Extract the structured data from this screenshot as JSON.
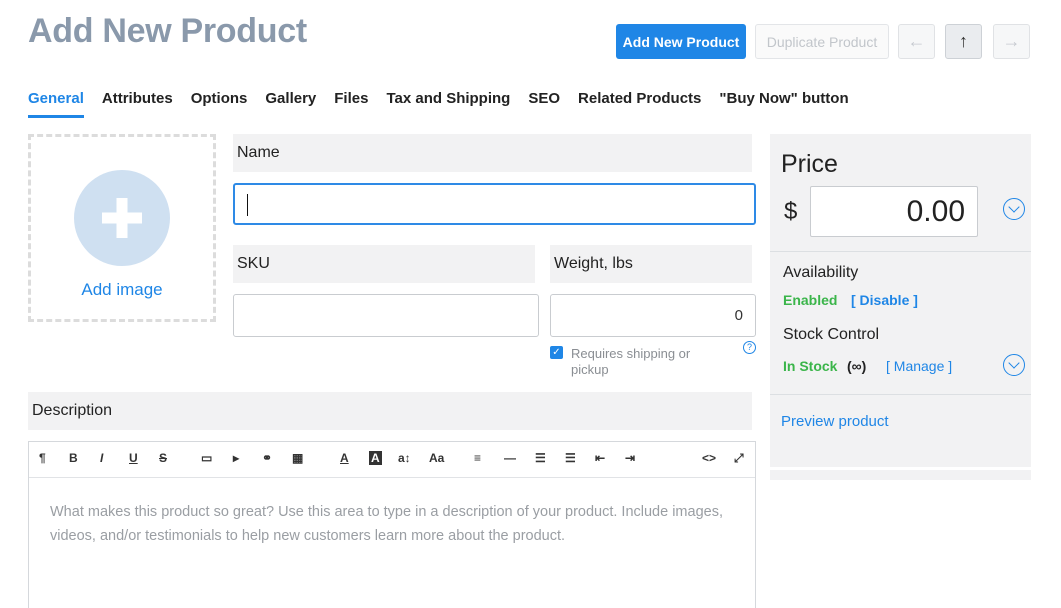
{
  "header": {
    "title": "Add New Product",
    "add_button": "Add New Product",
    "duplicate_button": "Duplicate Product",
    "prev_icon": "←",
    "up_icon": "↑",
    "next_icon": "→"
  },
  "tabs": [
    {
      "label": "General",
      "active": true
    },
    {
      "label": "Attributes"
    },
    {
      "label": "Options"
    },
    {
      "label": "Gallery"
    },
    {
      "label": "Files"
    },
    {
      "label": "Tax and Shipping"
    },
    {
      "label": "SEO"
    },
    {
      "label": "Related Products"
    },
    {
      "label": "\"Buy Now\" button"
    }
  ],
  "image": {
    "label": "Add image"
  },
  "form": {
    "name_label": "Name",
    "name_value": "",
    "sku_label": "SKU",
    "sku_value": "",
    "weight_label": "Weight, lbs",
    "weight_value": "0",
    "shipping_checkbox": "Requires shipping or pickup",
    "help_icon": "?"
  },
  "description": {
    "label": "Description",
    "placeholder": "What makes this product so great? Use this area to type in a description of your product. Include images, videos, and/or testimonials to help new customers learn more about the product.",
    "toolbar": {
      "paragraph": "¶",
      "bold": "B",
      "italic": "I",
      "underline": "U",
      "strike": "S",
      "image": "▭",
      "video": "▸",
      "link": "⚭",
      "table": "▦",
      "font_color": "A",
      "bg_color": "A",
      "font_size": "a↕",
      "font_family": "Aa",
      "align": "≡",
      "hr": "—",
      "ul": "☰",
      "ol": "☰",
      "outdent": "⇤",
      "indent": "⇥",
      "code": "<>",
      "fullscreen": "⤢"
    }
  },
  "price": {
    "title": "Price",
    "currency": "$",
    "value": "0.00"
  },
  "availability": {
    "title": "Availability",
    "state": "Enabled",
    "link": "[ Disable ]"
  },
  "stock": {
    "title": "Stock Control",
    "state": "In Stock",
    "infinity": "(∞)",
    "link": "[ Manage ]"
  },
  "preview": {
    "label": "Preview product"
  },
  "colors": {
    "accent": "#1f86e6",
    "success": "#3bb54a",
    "title": "#8a99ab"
  }
}
